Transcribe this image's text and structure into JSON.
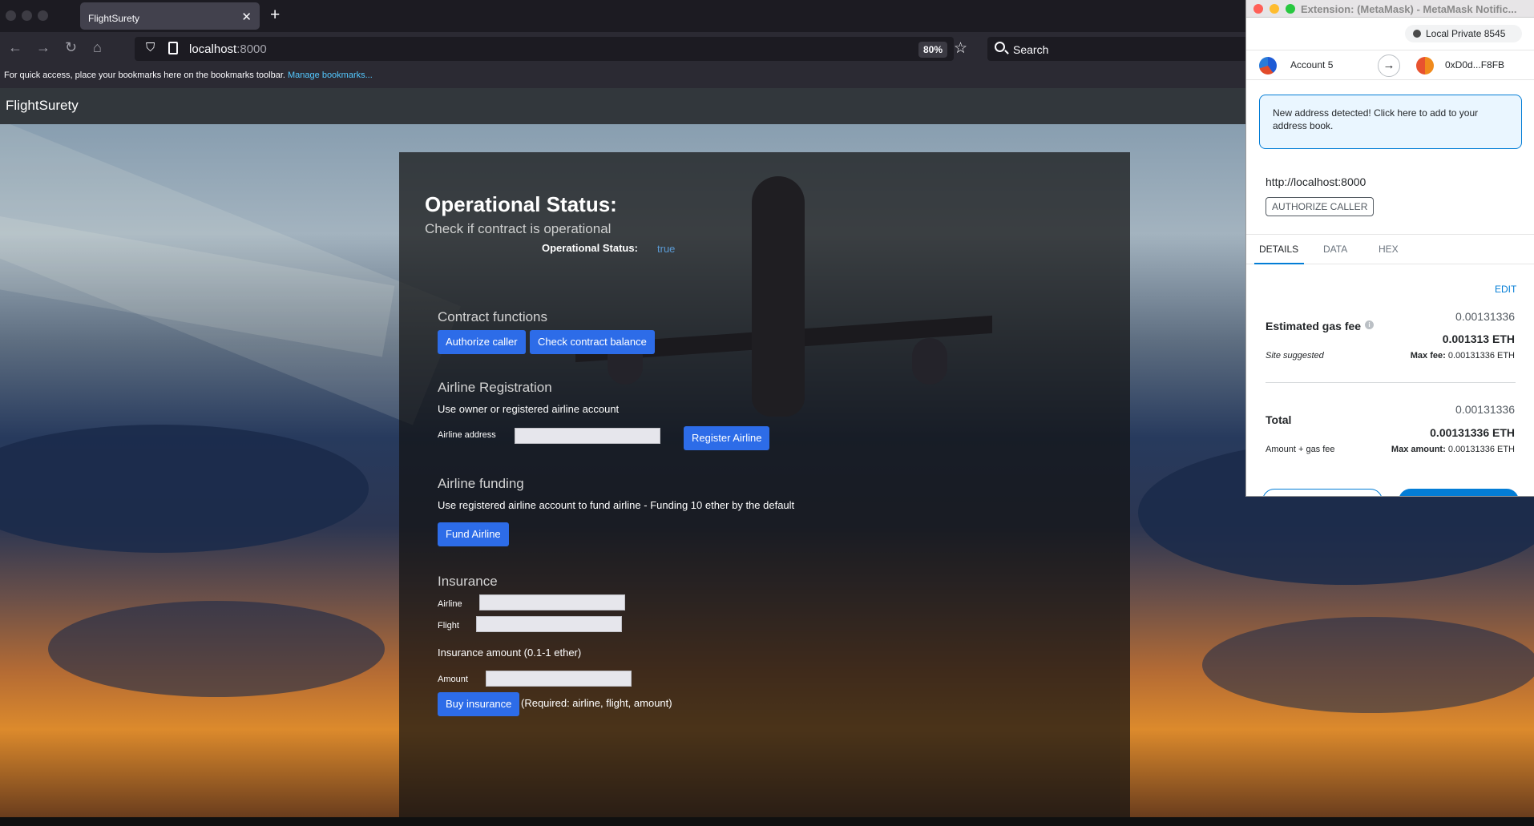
{
  "browser": {
    "tab_title": "FlightSurety",
    "url_host": "localhost",
    "url_port": ":8000",
    "zoom": "80%",
    "search_placeholder": "Search",
    "bookmarks_text": "For quick access, place your bookmarks here on the bookmarks toolbar.",
    "bookmarks_link": "Manage bookmarks..."
  },
  "app": {
    "brand": "FlightSurety",
    "operational": {
      "title": "Operational Status:",
      "subtitle": "Check if contract is operational",
      "status_label": "Operational Status:",
      "status_value": "true"
    },
    "contract": {
      "title": "Contract functions",
      "authorize_button": "Authorize caller",
      "balance_button": "Check contract balance"
    },
    "registration": {
      "title": "Airline Registration",
      "desc": "Use owner or registered airline account",
      "address_label": "Airline address",
      "register_button": "Register Airline"
    },
    "funding": {
      "title": "Airline funding",
      "desc": "Use registered airline account to fund airline - Funding 10 ether by the default",
      "fund_button": "Fund Airline"
    },
    "insurance": {
      "title": "Insurance",
      "airline_label": "Airline",
      "flight_label": "Flight",
      "amount_heading": "Insurance amount (0.1-1 ether)",
      "amount_label": "Amount",
      "buy_button": "Buy insurance",
      "required_note": "(Required: airline, flight, amount)"
    }
  },
  "metamask": {
    "window_title": "Extension: (MetaMask) - MetaMask Notific...",
    "network": "Local Private 8545",
    "from_account": "Account 5",
    "to_account": "0xD0d...F8FB",
    "alert": "New address detected! Click here to add to your address book.",
    "origin": "http://localhost:8000",
    "method": "AUTHORIZE CALLER",
    "tabs": [
      "DETAILS",
      "DATA",
      "HEX"
    ],
    "edit": "EDIT",
    "gas": {
      "label": "Estimated gas fee",
      "value_top": "0.00131336",
      "value_eth": "0.001313 ETH",
      "suggested": "Site suggested",
      "max_fee_label": "Max fee:",
      "max_fee_value": "0.00131336 ETH"
    },
    "total": {
      "label": "Total",
      "value_top": "0.00131336",
      "value_eth": "0.00131336 ETH",
      "sub_label": "Amount + gas fee",
      "max_amount_label": "Max amount:",
      "max_amount_value": "0.00131336 ETH"
    },
    "colors": {
      "accent": "#037dd6",
      "alert_bg": "#eaf6ff"
    }
  },
  "colors": {
    "primary_button": "#2d6ce8",
    "status_true": "#5b9bd5"
  }
}
